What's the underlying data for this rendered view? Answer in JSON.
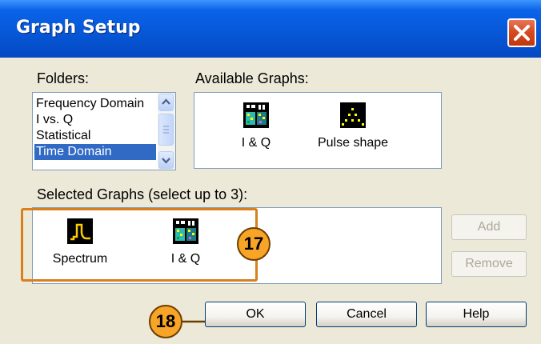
{
  "title": "Graph Setup",
  "folders": {
    "label": "Folders:",
    "items": [
      "Frequency Domain",
      "I vs. Q",
      "Statistical",
      "Time Domain"
    ],
    "selected": "Time Domain"
  },
  "available": {
    "label": "Available Graphs:",
    "items": [
      {
        "label": "I & Q",
        "icon": "iq-graph-icon"
      },
      {
        "label": "Pulse shape",
        "icon": "pulse-shape-graph-icon"
      }
    ]
  },
  "selected_graphs": {
    "label": "Selected Graphs (select up to 3):",
    "items": [
      {
        "label": "Spectrum",
        "icon": "spectrum-graph-icon"
      },
      {
        "label": "I & Q",
        "icon": "iq-graph-icon"
      }
    ]
  },
  "buttons": {
    "add": "Add",
    "remove": "Remove",
    "ok": "OK",
    "cancel": "Cancel",
    "help": "Help"
  },
  "callouts": {
    "c17": "17",
    "c18": "18"
  },
  "colors": {
    "titlebar": "#0758d8",
    "selection": "#316ac5",
    "callout": "#f7a427",
    "highlight_frame": "#d9801c",
    "close_button": "#d44c22"
  }
}
